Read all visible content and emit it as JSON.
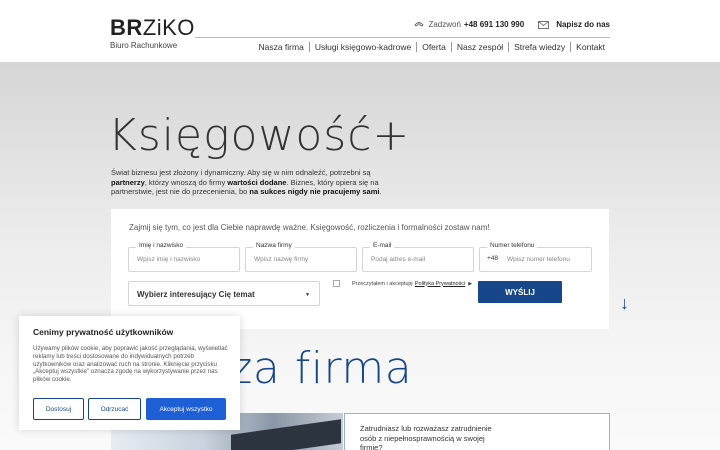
{
  "brand": {
    "logo_bold": "BR",
    "logo_rest": "ZiKO",
    "subtitle": "Biuro Rachunkowe"
  },
  "contact": {
    "call_label": "Zadzwoń",
    "phone": "+48 691 130 990",
    "write_label": "Napisz do nas"
  },
  "nav": [
    "Nasza firma",
    "Usługi księgowo-kadrowe",
    "Oferta",
    "Nasz zespół",
    "Strefa wiedzy",
    "Kontakt"
  ],
  "hero": {
    "title": "Księgowość+",
    "text_1": "Świat biznesu jest złożony i dynamiczny. Aby się w nim odnaleźć, potrzebni są ",
    "text_bold_1": "partnerzy",
    "text_2": ", którzy wnoszą do firmy ",
    "text_bold_2": "wartości dodane",
    "text_3": ". Biznes, który opiera się na partnerstwie, jest nie do przecenienia, bo ",
    "text_bold_3": "na sukces nigdy nie pracujemy sami",
    "text_4": "."
  },
  "form": {
    "intro": "Zajmij się tym, co jest dla Ciebie naprawdę ważne. Księgowość, rozliczenia i formalności zostaw nam!",
    "fields": [
      {
        "label": "Imię i nazwisko",
        "placeholder": "Wpisz imię i nazwisko"
      },
      {
        "label": "Nazwa firmy",
        "placeholder": "Wpisz nazwę firmy"
      },
      {
        "label": "E-mail",
        "placeholder": "Podaj adres e-mail"
      },
      {
        "label": "Numer telefonu",
        "prefix": "+48",
        "placeholder": "Wpisz numer telefonu"
      }
    ],
    "topic_select": "Wybierz interesujący Cię temat",
    "consent_text": "Przeczytałem i akceptuję",
    "consent_link": "Polityka Prywatności",
    "submit": "WYŚLIJ"
  },
  "section": {
    "title": "Nasza firma"
  },
  "info_box": {
    "text": "Zatrudniasz lub rozważasz zatrudnienie osób z niepełnosprawnością w swojej firmie?"
  },
  "cookie": {
    "title": "Cenimy prywatność użytkowników",
    "body": "Używamy plików cookie, aby poprawić jakość przeglądania, wyświetlać reklamy lub treści dostosowane do indywidualnych potrzeb użytkowników oraz analizować ruch na stronie. Kliknięcie przycisku „Akceptuj wszystkie” oznacza zgodę na wykorzystywanie przez nas plików cookie.",
    "customize": "Dostosuj",
    "reject": "Odrzucać",
    "accept": "Akceptuj wszystko"
  },
  "colors": {
    "brand_blue": "#17478a",
    "accept_blue": "#1f5fd6"
  }
}
